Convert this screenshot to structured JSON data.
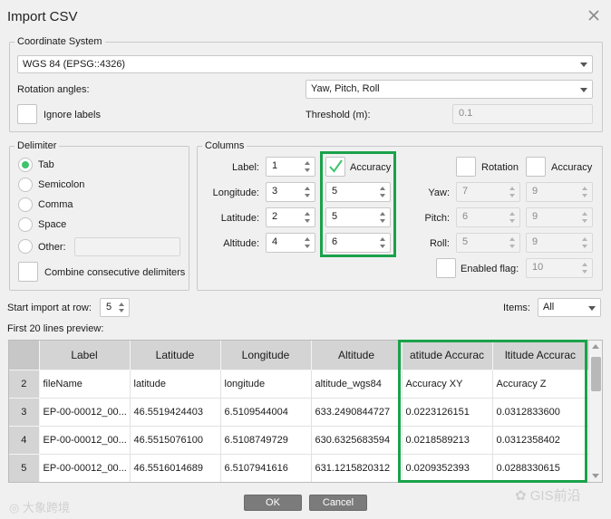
{
  "dialog": {
    "title": "Import CSV"
  },
  "coord": {
    "legend": "Coordinate System",
    "crs": "WGS 84 (EPSG::4326)",
    "rotation_label": "Rotation angles:",
    "rotation_value": "Yaw, Pitch, Roll",
    "ignore_labels": "Ignore labels",
    "threshold_label": "Threshold (m):",
    "threshold_value": "0.1"
  },
  "delimiter": {
    "legend": "Delimiter",
    "options": [
      "Tab",
      "Semicolon",
      "Comma",
      "Space",
      "Other:"
    ],
    "selected": "Tab",
    "combine": "Combine consecutive delimiters"
  },
  "columns": {
    "legend": "Columns",
    "label_label": "Label:",
    "label_value": "1",
    "accuracy_label": "Accuracy",
    "longitude_label": "Longitude:",
    "longitude_value": "3",
    "longitude_acc": "5",
    "latitude_label": "Latitude:",
    "latitude_value": "2",
    "latitude_acc": "5",
    "altitude_label": "Altitude:",
    "altitude_value": "4",
    "altitude_acc": "6",
    "rotation_label": "Rotation",
    "rot_accuracy_label": "Accuracy",
    "yaw_label": "Yaw:",
    "yaw_value": "7",
    "yaw_acc": "9",
    "pitch_label": "Pitch:",
    "pitch_value": "6",
    "pitch_acc": "9",
    "roll_label": "Roll:",
    "roll_value": "5",
    "roll_acc": "9",
    "enabled_label": "Enabled flag:",
    "enabled_value": "10"
  },
  "import": {
    "start_label": "Start import at row:",
    "start_value": "5",
    "items_label": "Items:",
    "items_value": "All",
    "preview_label": "First 20 lines preview:"
  },
  "preview": {
    "headers": [
      "Label",
      "Latitude",
      "Longitude",
      "Altitude",
      "atitude Accurac",
      "ltitude Accurac"
    ],
    "rows": [
      {
        "n": "2",
        "cells": [
          "fileName",
          "latitude",
          "longitude",
          "altitude_wgs84",
          "Accuracy XY",
          "Accuracy Z"
        ]
      },
      {
        "n": "3",
        "cells": [
          "EP-00-00012_00...",
          "46.5519424403",
          "6.5109544004",
          "633.2490844727",
          "0.0223126151",
          "0.0312833600"
        ]
      },
      {
        "n": "4",
        "cells": [
          "EP-00-00012_00...",
          "46.5515076100",
          "6.5108749729",
          "630.6325683594",
          "0.0218589213",
          "0.0312358402"
        ]
      },
      {
        "n": "5",
        "cells": [
          "EP-00-00012_00...",
          "46.5516014689",
          "6.5107941616",
          "631.1215820312",
          "0.0209352393",
          "0.0288330615"
        ]
      }
    ]
  },
  "buttons": {
    "ok": "OK",
    "cancel": "Cancel"
  },
  "watermark": {
    "left": "大象跨境",
    "right": "GIS前沿"
  },
  "colors": {
    "highlight": "#1aa24a",
    "radio_on": "#3ec46d",
    "check": "#3ec46d"
  }
}
